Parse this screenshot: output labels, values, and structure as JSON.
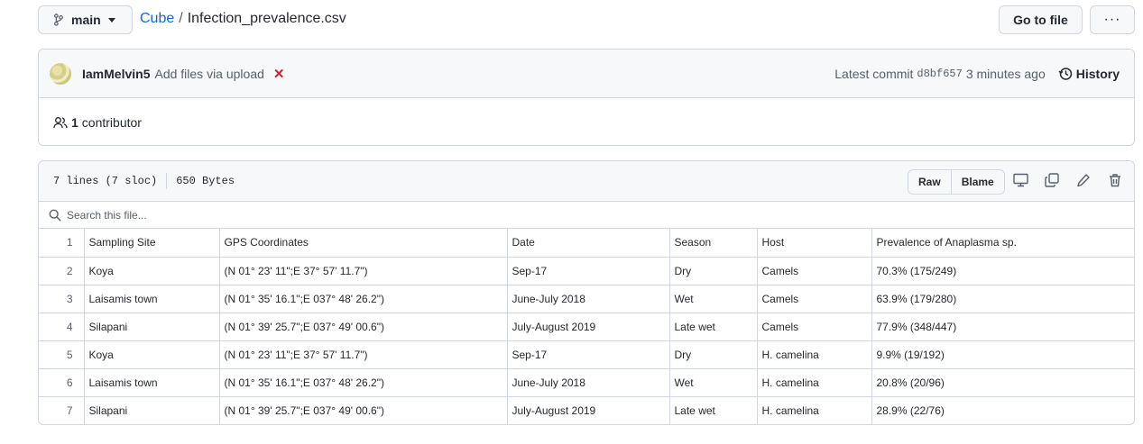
{
  "branch": {
    "name": "main"
  },
  "breadcrumb": {
    "repo": "Cube",
    "separator": "/",
    "file": "Infection_prevalence.csv"
  },
  "actions": {
    "goto_label": "Go to file",
    "more_label": "···"
  },
  "commit": {
    "author": "IamMelvin5",
    "message": "Add files via upload",
    "status": "✕",
    "latest_label": "Latest commit",
    "sha": "d8bf657",
    "time": "3 minutes ago",
    "history_label": "History"
  },
  "contributors": {
    "count": "1",
    "label": "contributor"
  },
  "file_info": {
    "lines": "7 lines (7 sloc)",
    "size": "650 Bytes",
    "raw_label": "Raw",
    "blame_label": "Blame"
  },
  "search": {
    "placeholder": "Search this file..."
  },
  "table": {
    "rows": [
      {
        "n": "1",
        "cells": [
          "Sampling Site",
          "GPS Coordinates",
          "Date",
          "Season",
          "Host",
          "Prevalence of Anaplasma sp."
        ]
      },
      {
        "n": "2",
        "cells": [
          "Koya",
          "(N 01° 23' 11\";E 37° 57' 11.7\")",
          "Sep-17",
          "Dry",
          "Camels",
          "70.3% (175/249)"
        ]
      },
      {
        "n": "3",
        "cells": [
          "Laisamis town",
          "(N 01° 35' 16.1\";E 037° 48' 26.2\")",
          "June-July 2018",
          "Wet",
          "Camels",
          "63.9% (179/280)"
        ]
      },
      {
        "n": "4",
        "cells": [
          "Silapani",
          "(N 01° 39' 25.7\";E 037° 49' 00.6\")",
          "July-August 2019",
          "Late wet",
          "Camels",
          "77.9% (348/447)"
        ]
      },
      {
        "n": "5",
        "cells": [
          "Koya",
          "(N 01° 23' 11\";E 37° 57' 11.7\")",
          "Sep-17",
          "Dry",
          "H. camelina",
          "9.9% (19/192)"
        ]
      },
      {
        "n": "6",
        "cells": [
          "Laisamis town",
          "(N 01° 35' 16.1\";E 037° 48' 26.2\")",
          "June-July 2018",
          "Wet",
          "H. camelina",
          "20.8% (20/96)"
        ]
      },
      {
        "n": "7",
        "cells": [
          "Silapani",
          "(N 01° 39' 25.7\";E 037° 49' 00.6\")",
          "July-August 2019",
          "Late wet",
          "H. camelina",
          "28.9% (22/76)"
        ]
      }
    ]
  },
  "colors": {
    "link": "#0969da",
    "border": "#d0d7de",
    "muted": "#57606a",
    "danger": "#cf222e",
    "subtle_bg": "#f6f8fa"
  },
  "icons": [
    "git-branch-icon",
    "caret-down-icon",
    "kebab-horizontal-icon",
    "x-icon",
    "history-icon",
    "people-icon",
    "desktop-icon",
    "copy-icon",
    "pencil-icon",
    "trash-icon",
    "search-icon"
  ]
}
